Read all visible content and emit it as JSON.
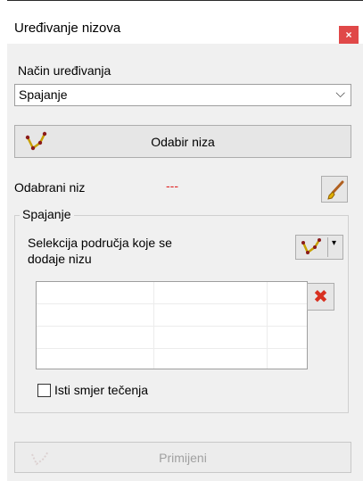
{
  "window": {
    "title": "Uređivanje nizova",
    "close_icon": "×"
  },
  "mode": {
    "label": "Način uređivanja",
    "selected": "Spajanje",
    "chevron": "⌵"
  },
  "pick_button": {
    "label": "Odabir niza"
  },
  "selected_string": {
    "label": "Odabrani niz",
    "value": "---"
  },
  "group": {
    "legend": "Spajanje",
    "selection_text": "Selekcija područja koje se dodaje nizu",
    "dropdown_arrow": "▾",
    "delete_icon": "✖",
    "same_direction_label": "Isti smjer tečenja",
    "same_direction_checked": false
  },
  "apply_button": {
    "label": "Primijeni"
  },
  "colors": {
    "accent_red": "#e02020",
    "close_bg": "#e04848"
  }
}
